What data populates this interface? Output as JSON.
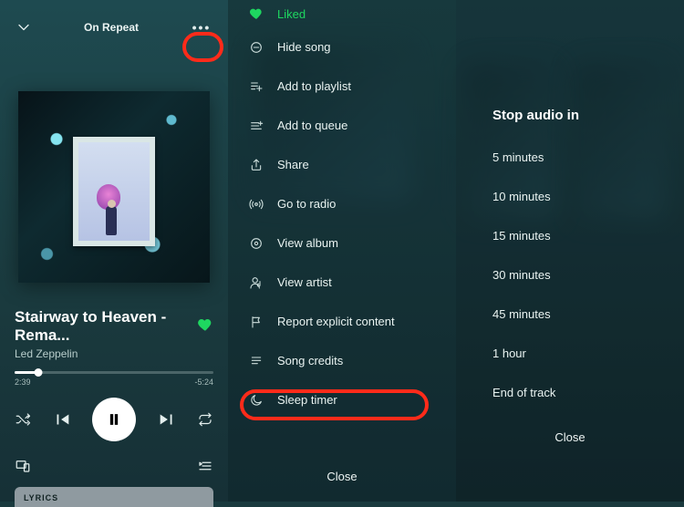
{
  "player": {
    "context_label": "On Repeat",
    "track_title": "Stairway to Heaven - Rema...",
    "artist": "Led Zeppelin",
    "elapsed": "2:39",
    "remaining": "-5:24",
    "lyrics_label": "LYRICS"
  },
  "context_menu": {
    "items": [
      {
        "icon": "heart",
        "label": "Liked",
        "liked": true
      },
      {
        "icon": "minus-circle",
        "label": "Hide song"
      },
      {
        "icon": "playlist-add",
        "label": "Add to playlist"
      },
      {
        "icon": "queue",
        "label": "Add to queue"
      },
      {
        "icon": "share",
        "label": "Share"
      },
      {
        "icon": "radio",
        "label": "Go to radio"
      },
      {
        "icon": "disc",
        "label": "View album"
      },
      {
        "icon": "artist",
        "label": "View artist"
      },
      {
        "icon": "flag",
        "label": "Report explicit content"
      },
      {
        "icon": "credits",
        "label": "Song credits"
      },
      {
        "icon": "moon",
        "label": "Sleep timer"
      }
    ],
    "close": "Close"
  },
  "sleep_timer": {
    "title": "Stop audio in",
    "options": [
      "5 minutes",
      "10 minutes",
      "15 minutes",
      "30 minutes",
      "45 minutes",
      "1 hour",
      "End of track"
    ],
    "close": "Close"
  }
}
